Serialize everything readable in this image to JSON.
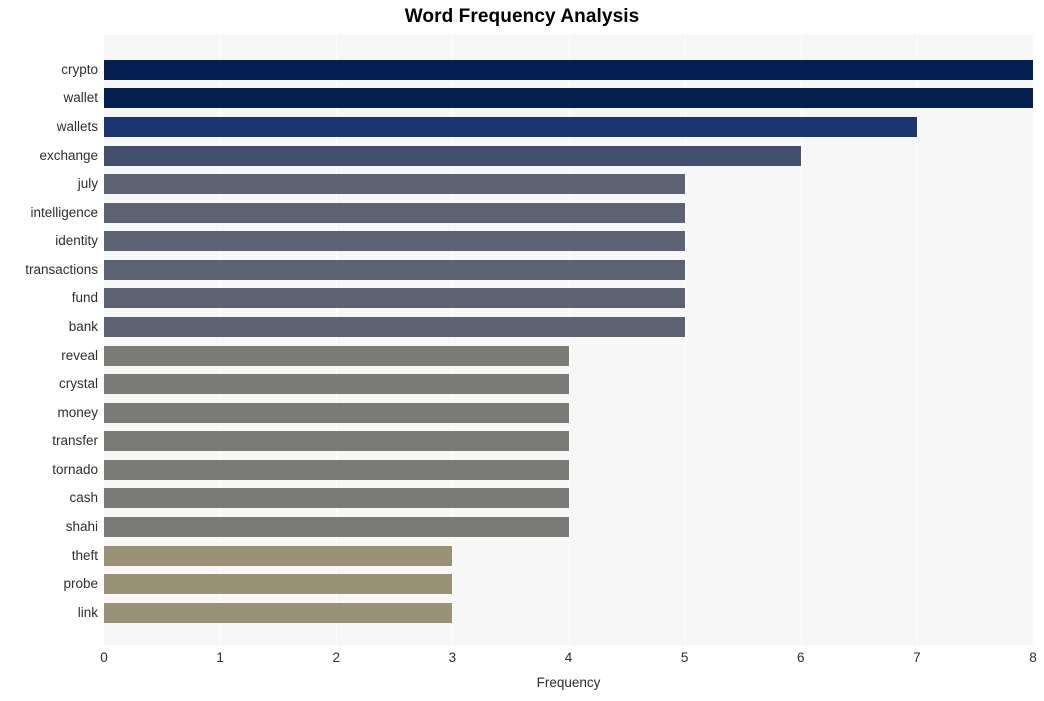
{
  "chart_data": {
    "type": "bar",
    "orientation": "horizontal",
    "title": "Word Frequency Analysis",
    "xlabel": "Frequency",
    "ylabel": "",
    "xlim": [
      0,
      8
    ],
    "xticks": [
      0,
      1,
      2,
      3,
      4,
      5,
      6,
      7,
      8
    ],
    "xticklabels": [
      "0",
      "1",
      "2",
      "3",
      "4",
      "5",
      "6",
      "7",
      "8"
    ],
    "grid": true,
    "grid_axis": "x",
    "legend": false,
    "categories": [
      "crypto",
      "wallet",
      "wallets",
      "exchange",
      "july",
      "intelligence",
      "identity",
      "transactions",
      "fund",
      "bank",
      "reveal",
      "crystal",
      "money",
      "transfer",
      "tornado",
      "cash",
      "shahi",
      "theft",
      "probe",
      "link"
    ],
    "values": [
      8,
      8,
      7,
      6,
      5,
      5,
      5,
      5,
      5,
      5,
      4,
      4,
      4,
      4,
      4,
      4,
      4,
      3,
      3,
      3
    ],
    "bar_colors": [
      "#042050",
      "#042050",
      "#1b3570",
      "#464f6e",
      "#5d6272",
      "#5d6272",
      "#5d6272",
      "#5d6272",
      "#5d6272",
      "#5d6272",
      "#7a7a76",
      "#7a7a76",
      "#7a7a76",
      "#7a7a76",
      "#7a7a76",
      "#7a7a76",
      "#7a7a76",
      "#999276",
      "#999276",
      "#999276"
    ],
    "plot_background": "#f7f7f7",
    "figure_background": "#ffffff",
    "gridline_color": "#ffffff",
    "tick_label_color": "#2e2e2e",
    "title_color": "#000000"
  }
}
